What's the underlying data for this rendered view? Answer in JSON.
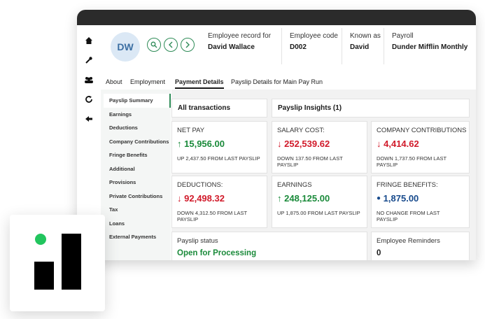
{
  "app": {
    "icon_bar": [
      "home-icon",
      "wrench-icon",
      "users-icon",
      "refresh-icon",
      "logout-icon"
    ]
  },
  "header": {
    "avatar_initials": "DW",
    "nav_icons": [
      "search-icon",
      "chevron-left-icon",
      "chevron-right-icon"
    ],
    "employee_record_label": "Employee record for",
    "employee_record_value": "David Wallace",
    "employee_code_label": "Employee code",
    "employee_code_value": "D002",
    "known_as_label": "Known as",
    "known_as_value": "David",
    "payroll_label": "Payroll",
    "payroll_value": "Dunder Mifflin Monthly"
  },
  "tabs": [
    "About",
    "Employment",
    "Payment Details",
    "Payslip Details for Main Pay Run"
  ],
  "active_tab": "Payment Details",
  "sidemenu": [
    "Payslip Summary",
    "Earnings",
    "Deductions",
    "Company Contributions",
    "Fringe Benefits",
    "Additional",
    "Provisions",
    "Private Contributions",
    "Tax",
    "Loans",
    "External Payments"
  ],
  "active_sidemenu": "Payslip Summary",
  "sections": {
    "all_transactions": "All transactions",
    "payslip_insights": "Payslip Insights (1)"
  },
  "cards": {
    "net_pay": {
      "label": "NET PAY",
      "value": "15,956.00",
      "sub": "UP 2,437.50 FROM LAST PAYSLIP",
      "trend": "up"
    },
    "salary_cost": {
      "label": "SALARY COST:",
      "value": "252,539.62",
      "sub": "DOWN 137.50 FROM LAST PAYSLIP",
      "trend": "down"
    },
    "company_contributions": {
      "label": "COMPANY CONTRIBUTIONS",
      "value": "4,414.62",
      "sub": "DOWN 1,737.50 FROM LAST PAYSLIP",
      "trend": "down"
    },
    "deductions": {
      "label": "DEDUCTIONS:",
      "value": "92,498.32",
      "sub": "DOWN 4,312.50 FROM LAST PAYSLIP",
      "trend": "down"
    },
    "earnings": {
      "label": "EARNINGS",
      "value": "248,125.00",
      "sub": "UP 1,875.00 FROM LAST PAYSLIP",
      "trend": "up"
    },
    "fringe_benefits": {
      "label": "FRINGE BENEFITS:",
      "value": "1,875.00",
      "sub": "NO CHANGE FROM LAST PAYSLIP",
      "trend": "none"
    }
  },
  "payslip_status": {
    "label": "Payslip status",
    "value": "Open for Processing"
  },
  "employee_reminders": {
    "label": "Employee Reminders",
    "value": "0"
  },
  "colors": {
    "accent_green": "#1a8a3a",
    "down_red": "#d11a2a",
    "neutral_blue": "#174a8c",
    "logo_dot": "#22c55e"
  }
}
